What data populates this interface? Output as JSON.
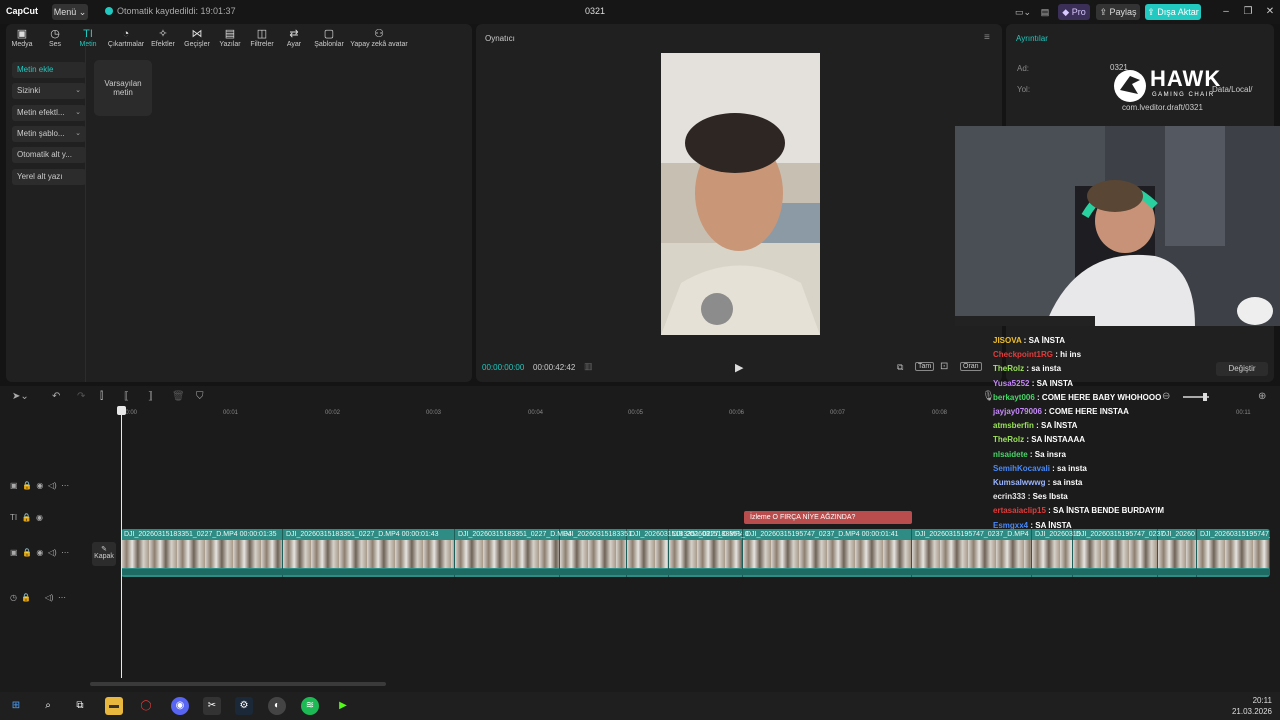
{
  "titlebar": {
    "logo": "CapCut",
    "menu": "Menü",
    "autosave": "Otomatik kaydedildi: 19:01:37",
    "project": "0321",
    "pro": "Pro",
    "share": "Paylaş",
    "export": "Dışa Aktar"
  },
  "tools": [
    {
      "label": "Medya",
      "icon": "▣"
    },
    {
      "label": "Ses",
      "icon": "◷"
    },
    {
      "label": "Metin",
      "icon": "TI"
    },
    {
      "label": "Çıkartmalar",
      "icon": "◔"
    },
    {
      "label": "Efektler",
      "icon": "✧"
    },
    {
      "label": "Geçişler",
      "icon": "⋈"
    },
    {
      "label": "Yazılar",
      "icon": "▤"
    },
    {
      "label": "Filtreler",
      "icon": "◫"
    },
    {
      "label": "Ayar",
      "icon": "⇄"
    },
    {
      "label": "Şablonlar",
      "icon": "▢"
    },
    {
      "label": "Yapay zekâ avatar",
      "icon": "⚇"
    }
  ],
  "sidemenu": [
    {
      "label": "Metin ekle",
      "chev": ""
    },
    {
      "label": "Sizinki",
      "chev": "⌄"
    },
    {
      "label": "Metin efektl...",
      "chev": "⌄"
    },
    {
      "label": "Metin şablo...",
      "chev": "⌄"
    },
    {
      "label": "Otomatik alt y...",
      "chev": ""
    },
    {
      "label": "Yerel alt yazı",
      "chev": ""
    }
  ],
  "tile": {
    "line1": "Varsayılan",
    "line2": "metin"
  },
  "player": {
    "title": "Oynatıcı",
    "current_time": "00:00:00:00",
    "total_time": "00:00:42:42",
    "full": "Tam",
    "ratio": "Oran"
  },
  "details": {
    "title": "Ayrıntılar",
    "name_label": "Ad:",
    "name_value": "0321",
    "path_label": "Yol:",
    "path_line1": "Data/Local/",
    "path_line2": "com.lveditor.draft/0321",
    "change_button": "Değiştir"
  },
  "overlay": {
    "brand": "HAWK",
    "brand_sub": "GAMING CHAIR"
  },
  "ruler": [
    "00:00",
    "00:01",
    "00:02",
    "00:03",
    "00:04",
    "00:05",
    "00:06",
    "00:07",
    "00:08",
    "00:11"
  ],
  "clips": [
    {
      "label": "DJI_20260315183351_0227_D.MP4  00:00:01:35"
    },
    {
      "label": "DJI_20260315183351_0227_D.MP4  00:00:01:43"
    },
    {
      "label": "DJI_20260315183351_0227_D.MP4"
    },
    {
      "label": "DJI_20260315183351"
    },
    {
      "label": "DJI_20260315183351_0227_D.MP4"
    },
    {
      "label": "DJI_20260315183351_0"
    },
    {
      "label": "DJI_20260315195747_0237_D.MP4  00:00:01:41"
    },
    {
      "label": "DJI_20260315195747_0237_D.MP4"
    },
    {
      "label": "DJI_20260315"
    },
    {
      "label": "DJI_20260315195747_0237"
    },
    {
      "label": "DJI_20260"
    },
    {
      "label": "DJI_20260315195747_0"
    }
  ],
  "red_clip": {
    "label": "İzleme   O FIRÇA NİYE AĞZINDA?"
  },
  "kapak": "Kapak",
  "chat": [
    {
      "user": "JISOVA",
      "msg": "SA İNSTA",
      "color": "#f0c02a"
    },
    {
      "user": "Checkpoint1RG",
      "msg": "hi ins",
      "color": "#e33b3b"
    },
    {
      "user": "TheRolz",
      "msg": "sa insta",
      "color": "#9be35a"
    },
    {
      "user": "Yusa5252",
      "msg": "SA INSTA",
      "color": "#c58af7"
    },
    {
      "user": "berkayt006",
      "msg": "COME HERE BABY WHOHOOO",
      "color": "#4ad66a"
    },
    {
      "user": "jayjay079006",
      "msg": "COME HERE INSTAA",
      "color": "#c58af7"
    },
    {
      "user": "atmsberfin",
      "msg": "SA İNSTA",
      "color": "#9be35a"
    },
    {
      "user": "TheRolz",
      "msg": "SA İNSTAAAA",
      "color": "#9be35a"
    },
    {
      "user": "nlsaidete",
      "msg": "Sa insra",
      "color": "#4ad66a"
    },
    {
      "user": "SemihKocavali",
      "msg": "sa insta",
      "color": "#4a8af7"
    },
    {
      "user": "Kumsalwwwg",
      "msg": "sa insta",
      "color": "#9bb5ff"
    },
    {
      "user": "ecrin333",
      "msg": "Ses lbsta",
      "color": "#e6e6e6"
    },
    {
      "user": "ertasaiaclip15",
      "msg": "SA İNSTA BENDE BURDAYIM",
      "color": "#e33b3b"
    },
    {
      "user": "Esmgxx4",
      "msg": "SA İNSTA",
      "color": "#4a8af7"
    }
  ],
  "clock": {
    "time": "20:11",
    "date": "21.03.2026"
  },
  "colors": {
    "accent": "#21c9c0",
    "clip": "#2e8c84",
    "red_clip": "#b94c4c"
  }
}
